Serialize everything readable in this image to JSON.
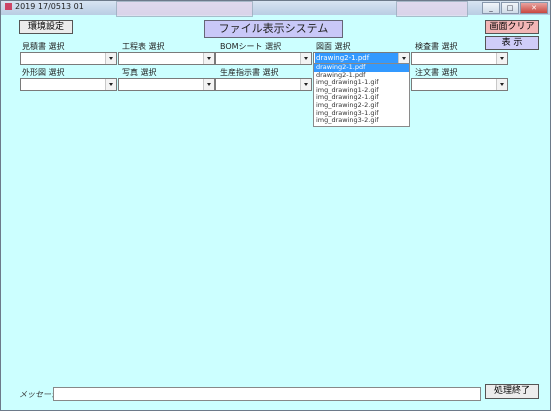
{
  "window": {
    "title": "2019 17/0513 01",
    "controls": [
      "_",
      "□",
      "✕"
    ]
  },
  "app": {
    "title": "ファイル表示システム",
    "env_button": "環境設定",
    "clear_button": "画面クリア",
    "display_button": "表 示",
    "exit_button": "処理終了",
    "message_label": "メッセージ",
    "message_value": ""
  },
  "fields": [
    {
      "label": "見積書 選択",
      "value": ""
    },
    {
      "label": "工程表 選択",
      "value": ""
    },
    {
      "label": "BOMシート 選択",
      "value": ""
    },
    {
      "label": "図面 選択",
      "value": "drawing2-1.pdf",
      "open": true
    },
    {
      "label": "検査書 選択",
      "value": ""
    },
    {
      "label": "外形図 選択",
      "value": ""
    },
    {
      "label": "写真 選択",
      "value": ""
    },
    {
      "label": "生産指示書 選択",
      "value": ""
    },
    {
      "label": "注文書 選択",
      "value": ""
    }
  ],
  "dropdown_options": [
    "drawing2-1.pdf",
    "drawing2-1.pdf",
    "img_drawing1-1.gif",
    "img_drawing1-2.gif",
    "img_drawing2-1.gif",
    "img_drawing2-2.gif",
    "img_drawing3-1.gif",
    "img_drawing3-2.gif"
  ],
  "dropdown_highlight_index": 0,
  "colors": {
    "background": "#ccffff",
    "title_panel": "#c9c8f8",
    "selection": "#3399ff"
  }
}
